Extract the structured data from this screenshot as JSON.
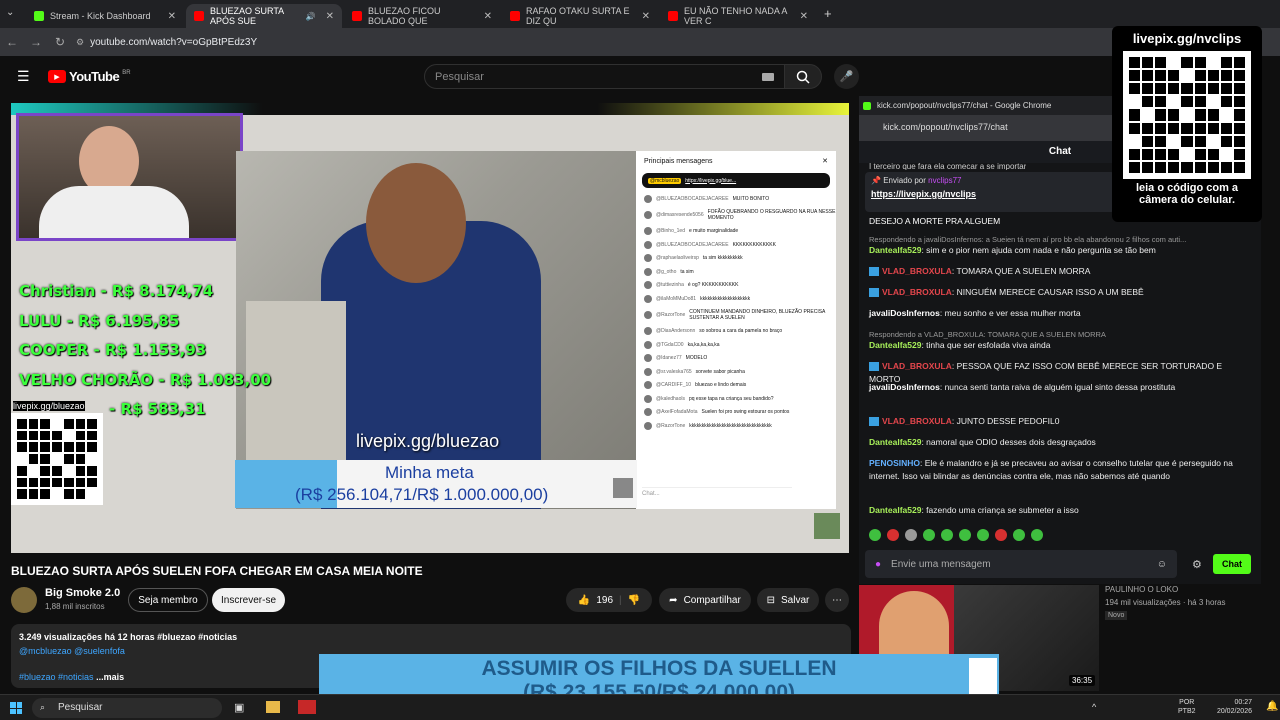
{
  "browser": {
    "tabs": [
      {
        "label": "Stream - Kick Dashboard",
        "color": "#53fc18"
      },
      {
        "label": "BLUEZAO SURTA APÓS SUE",
        "color": "#ff0000"
      },
      {
        "label": "BLUEZAO FICOU BOLADO QUE",
        "color": "#ff0000"
      },
      {
        "label": "RAFAO OTAKU SURTA E DIZ QU",
        "color": "#ff0000"
      },
      {
        "label": "EU NÃO TENHO NADA A VER C",
        "color": "#ff0000"
      }
    ],
    "url": "youtube.com/watch?v=oGpBtPEdz3Y"
  },
  "youtube": {
    "logo": "YouTube",
    "region": "BR",
    "search_placeholder": "Pesquisar",
    "video_title": "BLUEZAO SURTA APÓS SUELEN FOFA CHEGAR EM CASA MEIA NOITE",
    "channel": {
      "name": "Big Smoke 2.0",
      "subs": "1,88 mil inscritos"
    },
    "join_label": "Seja membro",
    "subscribe_label": "Inscrever-se",
    "likes": "196",
    "share_label": "Compartilhar",
    "save_label": "Salvar",
    "desc": {
      "stats": "3.249 visualizações  há 12 horas  #bluezao #noticias",
      "mentions": "@mcbluezao @suelenfofa",
      "tags": "#bluezao #noticias",
      "more": "...mais"
    }
  },
  "overlay": {
    "donors": [
      "Christian - R$ 8.174,74",
      "LULU - R$ 6.195,85",
      "COOPER - R$ 1.153,93",
      "VELHO CHORÃO - R$ 1.083,00",
      "- R$ 583,31"
    ],
    "qr_caption": "livepix.gg/bluezao",
    "livepix": "livepix.gg/bluezao",
    "meta_title": "Minha meta",
    "meta_value": "(R$ 256.104,71/R$ 1.000.000,00)",
    "insta_header": "Principais mensagens",
    "insta_pinned_user": "@mcbluezao",
    "insta_pinned_link": "https://livepix.gg/blue...",
    "insta_comments": [
      {
        "user": "@BLUEZAOBOCADEJACAREE",
        "text": "MUITO BONITO"
      },
      {
        "user": "@dimasresende5056",
        "text": "FOFÃO QUEBRANDO O RESGUARDO NA RUA NESSE MOMENTO"
      },
      {
        "user": "@Binho_1ed",
        "text": "e muito marginalidade"
      },
      {
        "user": "@BLUEZAOBOCADEJACAREE",
        "text": "KKKKKKKKKKKKK"
      },
      {
        "user": "@raphaelaoliveirsp",
        "text": "ta sim kkkkkkkkkk"
      },
      {
        "user": "@g_otho",
        "text": "ta sim"
      },
      {
        "user": "@tuttiezinha",
        "text": "é og? KKKKKKKKKKK"
      },
      {
        "user": "@ilaMoMMuDo81",
        "text": "kkkkkkkkkkkkkkkkkkkk"
      },
      {
        "user": "@RazorTone",
        "text": "CONTINUEM MANDANDO DINHEIRO, BLUEZÃO PRECISA SUSTENTAR A SUELEN"
      },
      {
        "user": "@DiasAndersonn",
        "text": "so sobrou a cara da pamela no braço"
      },
      {
        "user": "@TGdaCD0",
        "text": "ka,ka,ka,ka,ka"
      },
      {
        "user": "@Idanez77",
        "text": "MODELO"
      },
      {
        "user": "@sr.valeska765",
        "text": "sorvete sabor picanha"
      },
      {
        "user": "@CARDIFF_10",
        "text": "bluezao e lindo demais"
      },
      {
        "user": "@kaledhaols",
        "text": "pq esse tapa na criança seu bandido?"
      },
      {
        "user": "@AxelFofadaMota",
        "text": "Suelen foi pro swing estourar os pontos"
      },
      {
        "user": "@RazorTone",
        "text": "kkkkkkkkkkkkkkkkkkkkkkkkkkkkkkkkk"
      }
    ],
    "insta_input": "Chat..."
  },
  "chat": {
    "window_title": "kick.com/popout/nvclips77/chat - Google Chrome",
    "url": "kick.com/popout/nvclips77/chat",
    "header": "Chat",
    "top_partial": "I terceiro que fara ela comecar a se importar",
    "sent_by": "Enviado por",
    "sent_user": "nvclips77",
    "sent_link": "https://livepix.gg/nvclips",
    "partial2": "DESEJO A MORTE PRA ALGUEM",
    "messages": [
      {
        "reply": "Respondendo a javaliDosInfernos: a Sueien tá nem aí pro bb ela abandonou 2 filhos com auti...",
        "user": "Dantealfa529",
        "cls": "u-green",
        "text": ": sim e o pior nem ajuda com nada e não pergunta se tão bem",
        "emote": false
      },
      {
        "reply": "",
        "user": "VLAD_BROXULA",
        "cls": "u-red",
        "text": ": TOMARA QUE A SUELEN MORRA",
        "emote": true
      },
      {
        "reply": "",
        "user": "VLAD_BROXULA",
        "cls": "u-red",
        "text": ": NINGUÉM MERECE CAUSAR ISSO A UM BEBÊ",
        "emote": true
      },
      {
        "reply": "",
        "user": "javaliDosInfernos",
        "cls": "u-white",
        "text": ": meu sonho e ver essa mulher morta",
        "emote": false
      },
      {
        "reply": "Respondendo a VLAD_BROXULA: TOMARA QUE A SUELEN MORRA",
        "user": "Dantealfa529",
        "cls": "u-green",
        "text": ": tinha que ser esfolada viva ainda",
        "emote": false
      },
      {
        "reply": "",
        "user": "VLAD_BROXULA",
        "cls": "u-red",
        "text": ": PESSOA QUE FAZ ISSO COM BEBÊ MERECE SER TORTURADO E MORTO",
        "emote": true
      },
      {
        "reply": "",
        "user": "javaliDosInfernos",
        "cls": "u-white",
        "text": ": nunca senti tanta raiva de alguém igual sinto dessa prostituta",
        "emote": false
      },
      {
        "reply": "",
        "user": "VLAD_BROXULA",
        "cls": "u-red",
        "text": ": JUNTO DESSE PEDOFIL0",
        "emote": true
      },
      {
        "reply": "",
        "user": "Dantealfa529",
        "cls": "u-green",
        "text": ": namoral que ODIO desses dois desgraçados",
        "emote": false
      },
      {
        "reply": "",
        "user": "PENOSINHO",
        "cls": "u-blue",
        "text": ": Ele é malandro e já se precaveu ao avisar o conselho tutelar que é perseguido na internet. Isso vai blindar as denúncias contra ele, mas não sabemos até quando",
        "emote": false
      },
      {
        "reply": "",
        "user": "Dantealfa529",
        "cls": "u-green",
        "text": ": fazendo uma criança se submeter a isso",
        "emote": false
      }
    ],
    "input_placeholder": "Envie uma mensagem",
    "send_label": "Chat"
  },
  "qr_overlay": {
    "title": "livepix.gg/nvclips",
    "caption": "leia o código com a câmera do celular."
  },
  "sidebar_video": {
    "channel": "PAULINHO O LOKO",
    "views": "194 mil visualizações · há 3 horas",
    "badge": "Novo",
    "duration": "36:35"
  },
  "banner": {
    "line1": "ASSUMIR OS FILHOS DA SUELLEN",
    "line2": "(R$ 23.155,50/R$ 24.000,00)"
  },
  "taskbar": {
    "search": "Pesquisar",
    "lang": "POR",
    "layout": "PTB2",
    "time": "00:27",
    "date": "20/02/2026"
  }
}
